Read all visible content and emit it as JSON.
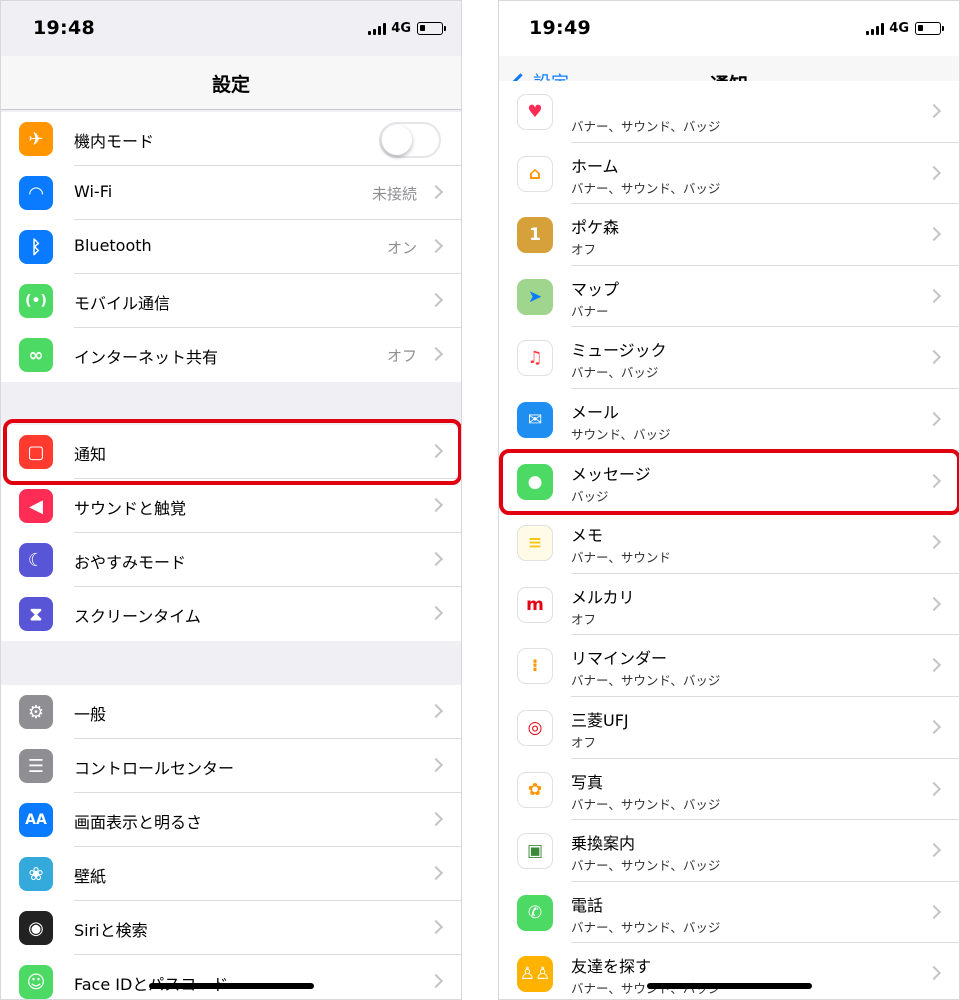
{
  "left": {
    "status": {
      "time": "19:48",
      "network": "4G"
    },
    "title": "設定",
    "group1": [
      {
        "label": "機内モード",
        "value": "",
        "icon": "airplane-icon",
        "color": "#ff9500",
        "glyph": "✈",
        "toggle": true
      },
      {
        "label": "Wi-Fi",
        "value": "未接続",
        "icon": "wifi-icon",
        "color": "#0a7aff",
        "glyph": "◠"
      },
      {
        "label": "Bluetooth",
        "value": "オン",
        "icon": "bluetooth-icon",
        "color": "#0a7aff",
        "glyph": "ᛒ"
      },
      {
        "label": "モバイル通信",
        "value": "",
        "icon": "antenna-icon",
        "color": "#4cd964",
        "glyph": "(•)"
      },
      {
        "label": "インターネット共有",
        "value": "オフ",
        "icon": "link-icon",
        "color": "#4cd964",
        "glyph": "∞"
      }
    ],
    "group2": [
      {
        "label": "通知",
        "icon": "notification-icon",
        "color": "#ff3b30",
        "glyph": "▢"
      },
      {
        "label": "サウンドと触覚",
        "icon": "speaker-icon",
        "color": "#ff2d55",
        "glyph": "◀"
      },
      {
        "label": "おやすみモード",
        "icon": "moon-icon",
        "color": "#5856d6",
        "glyph": "☾"
      },
      {
        "label": "スクリーンタイム",
        "icon": "hourglass-icon",
        "color": "#5856d6",
        "glyph": "⧗"
      }
    ],
    "group3": [
      {
        "label": "一般",
        "icon": "gear-icon",
        "color": "#8e8e93",
        "glyph": "⚙"
      },
      {
        "label": "コントロールセンター",
        "icon": "toggles-icon",
        "color": "#8e8e93",
        "glyph": "☰"
      },
      {
        "label": "画面表示と明るさ",
        "icon": "text-size-icon",
        "color": "#0a7aff",
        "glyph": "AA"
      },
      {
        "label": "壁紙",
        "icon": "flower-icon",
        "color": "#34aadc",
        "glyph": "❀"
      },
      {
        "label": "Siriと検索",
        "icon": "siri-icon",
        "color": "#222",
        "glyph": "◉"
      },
      {
        "label": "Face IDとパスコード",
        "icon": "face-id-icon",
        "color": "#4cd964",
        "glyph": "☺"
      }
    ]
  },
  "right": {
    "status": {
      "time": "19:49",
      "network": "4G"
    },
    "back_label": "設定",
    "title": "通知",
    "apps": [
      {
        "label": "",
        "sub": "バナー、サウンド、バッジ",
        "icon": "health-icon",
        "color": "#ffffff",
        "glyph": "♥",
        "glyph_color": "#ff2d55"
      },
      {
        "label": "ホーム",
        "sub": "バナー、サウンド、バッジ",
        "icon": "home-icon",
        "color": "#ffffff",
        "glyph": "⌂",
        "glyph_color": "#ff9500"
      },
      {
        "label": "ポケ森",
        "sub": "オフ",
        "icon": "pokemori-icon",
        "color": "#d6a13a",
        "glyph": "1",
        "glyph_color": "#ffffff"
      },
      {
        "label": "マップ",
        "sub": "バナー",
        "icon": "maps-icon",
        "color": "#9fd58c",
        "glyph": "➤",
        "glyph_color": "#0a7aff"
      },
      {
        "label": "ミュージック",
        "sub": "バナー、バッジ",
        "icon": "music-icon",
        "color": "#ffffff",
        "glyph": "♫",
        "glyph_color": "#fc3c44"
      },
      {
        "label": "メール",
        "sub": "サウンド、バッジ",
        "icon": "mail-icon",
        "color": "#1f8ef1",
        "glyph": "✉",
        "glyph_color": "#ffffff"
      },
      {
        "label": "メッセージ",
        "sub": "バッジ",
        "icon": "messages-icon",
        "color": "#4cd964",
        "glyph": "●",
        "glyph_color": "#ffffff"
      },
      {
        "label": "メモ",
        "sub": "バナー、サウンド",
        "icon": "notes-icon",
        "color": "#fffbe6",
        "glyph": "≡",
        "glyph_color": "#f5c518"
      },
      {
        "label": "メルカリ",
        "sub": "オフ",
        "icon": "mercari-icon",
        "color": "#ffffff",
        "glyph": "m",
        "glyph_color": "#e60012"
      },
      {
        "label": "リマインダー",
        "sub": "バナー、サウンド、バッジ",
        "icon": "reminders-icon",
        "color": "#ffffff",
        "glyph": "⁝",
        "glyph_color": "#ff9500"
      },
      {
        "label": "三菱UFJ",
        "sub": "オフ",
        "icon": "mufg-icon",
        "color": "#ffffff",
        "glyph": "◎",
        "glyph_color": "#e60012"
      },
      {
        "label": "写真",
        "sub": "バナー、サウンド、バッジ",
        "icon": "photos-icon",
        "color": "#ffffff",
        "glyph": "✿",
        "glyph_color": "#ff9500"
      },
      {
        "label": "乗換案内",
        "sub": "バナー、サウンド、バッジ",
        "icon": "transit-icon",
        "color": "#ffffff",
        "glyph": "▣",
        "glyph_color": "#3a8a3a"
      },
      {
        "label": "電話",
        "sub": "バナー、サウンド、バッジ",
        "icon": "phone-icon",
        "color": "#4cd964",
        "glyph": "✆",
        "glyph_color": "#ffffff"
      },
      {
        "label": "友達を探す",
        "sub": "バナー、サウンド、バッジ",
        "icon": "find-friends-icon",
        "color": "#ffb300",
        "glyph": "♙♙",
        "glyph_color": "#ffffff"
      }
    ]
  },
  "highlight_color": "#e1000f"
}
